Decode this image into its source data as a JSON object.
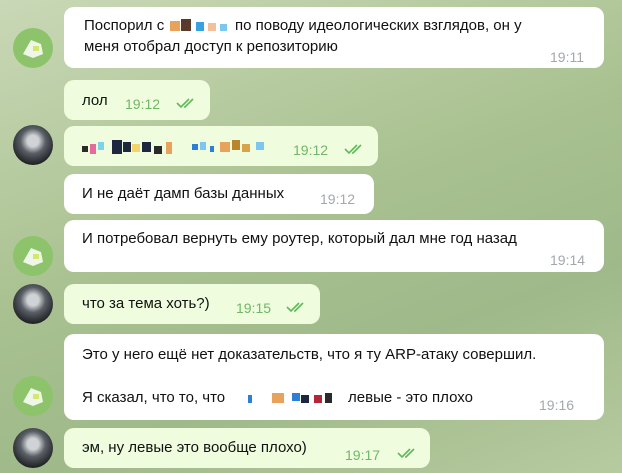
{
  "colors": {
    "incoming_bubble": "#ffffff",
    "outgoing_bubble": "#effdde",
    "outgoing_time": "#70b766",
    "incoming_time": "#a3a8ad",
    "read_ticks": "#5fb85a",
    "green_avatar": "#8cc36b"
  },
  "messages": [
    {
      "lines": [
        "Поспорил с",
        "по поводу идеологических взглядов, он у",
        "меня отобрал доступ к репозиторию"
      ],
      "time": "19:11"
    },
    {
      "text": "лол",
      "time": "19:12",
      "status": "read-ticks-icon"
    },
    {
      "text": "",
      "time": "19:12",
      "status": "read-ticks-icon"
    },
    {
      "text": "И не даёт дамп базы данных",
      "time": "19:12"
    },
    {
      "text": "И потребовал вернуть ему роутер, который дал мне год назад",
      "time": "19:14"
    },
    {
      "text": "что за тема хоть?)",
      "time": "19:15",
      "status": "read-ticks-icon"
    },
    {
      "line1": "Это у него ещё нет доказательств, что я ту ARP-атаку совершил.",
      "line2_pre": "Я сказал, что то, что",
      "line2_post": "левые - это плохо",
      "time": "19:16"
    },
    {
      "text": "эм, ну левые это вообще плохо)",
      "time": "19:17",
      "status": "read-ticks-icon"
    }
  ]
}
